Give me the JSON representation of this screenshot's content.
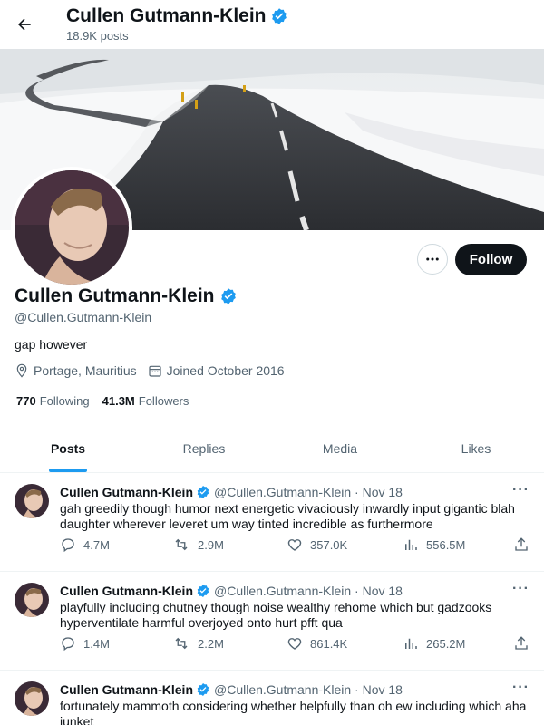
{
  "header": {
    "title": "Cullen Gutmann-Klein",
    "posts_count": "18.9K posts"
  },
  "profile": {
    "name": "Cullen Gutmann-Klein",
    "handle": "@Cullen.Gutmann-Klein",
    "bio": "gap however",
    "location": "Portage, Mauritius",
    "joined": "Joined October 2016",
    "following_count": "770",
    "following_label": "Following",
    "followers_count": "41.3M",
    "followers_label": "Followers",
    "follow_label": "Follow"
  },
  "tabs": [
    {
      "label": "Posts",
      "active": true
    },
    {
      "label": "Replies",
      "active": false
    },
    {
      "label": "Media",
      "active": false
    },
    {
      "label": "Likes",
      "active": false
    }
  ],
  "tweets": [
    {
      "name": "Cullen Gutmann-Klein",
      "meta": "@Cullen.Gutmann-Klein · Nov 18",
      "text": "gah greedily though humor next energetic vivaciously inwardly input gigantic blah daughter wherever leveret um way tinted incredible as furthermore",
      "replies": "4.7M",
      "reposts": "2.9M",
      "likes": "357.0K",
      "views": "556.5M"
    },
    {
      "name": "Cullen Gutmann-Klein",
      "meta": "@Cullen.Gutmann-Klein · Nov 18",
      "text": "playfully including chutney though noise wealthy rehome which but gadzooks hyperventilate harmful overjoyed onto hurt pfft qua",
      "replies": "1.4M",
      "reposts": "2.2M",
      "likes": "861.4K",
      "views": "265.2M"
    },
    {
      "name": "Cullen Gutmann-Klein",
      "meta": "@Cullen.Gutmann-Klein · Nov 18",
      "text": "fortunately mammoth considering whether helpfully than oh ew including which aha junket",
      "replies": "",
      "reposts": "",
      "likes": "",
      "views": ""
    }
  ],
  "colors": {
    "accent": "#1d9bf0",
    "text": "#0f1419",
    "muted": "#536471",
    "follow_bg": "#0f1419"
  }
}
